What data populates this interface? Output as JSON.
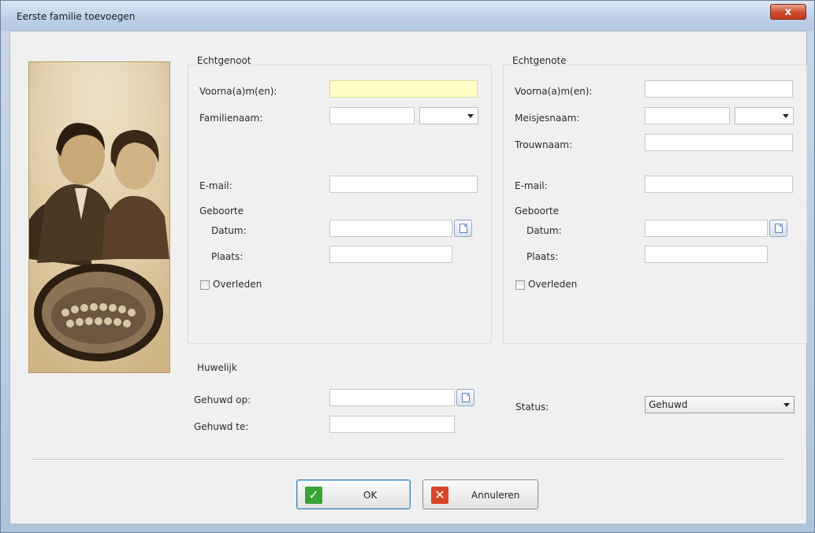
{
  "window": {
    "title": "Eerste familie toevoegen",
    "close_label": "x"
  },
  "husband": {
    "section_title": "Echtgenoot",
    "first_names_label": "Voorna(a)m(en):",
    "family_name_label": "Familienaam:",
    "email_label": "E-mail:",
    "birth_label": "Geboorte",
    "date_label": "Datum:",
    "place_label": "Plaats:",
    "deceased_label": "Overleden",
    "first_names_value": "",
    "family_name_value": "",
    "email_value": "",
    "birth_date_value": "",
    "birth_place_value": ""
  },
  "wife": {
    "section_title": "Echtgenote",
    "first_names_label": "Voorna(a)m(en):",
    "maiden_name_label": "Meisjesnaam:",
    "married_name_label": "Trouwnaam:",
    "email_label": "E-mail:",
    "birth_label": "Geboorte",
    "date_label": "Datum:",
    "place_label": "Plaats:",
    "deceased_label": "Overleden",
    "first_names_value": "",
    "maiden_name_value": "",
    "married_name_value": "",
    "email_value": "",
    "birth_date_value": "",
    "birth_place_value": ""
  },
  "marriage": {
    "section_title": "Huwelijk",
    "married_on_label": "Gehuwd op:",
    "married_at_label": "Gehuwd te:",
    "status_label": "Status:",
    "status_value": "Gehuwd",
    "married_on_value": "",
    "married_at_value": ""
  },
  "buttons": {
    "ok_label": "OK",
    "cancel_label": "Annuleren"
  },
  "colors": {
    "highlight_field": "#ffffc6",
    "ok_icon": "#3aa335",
    "cancel_icon": "#d9452b"
  },
  "icons": {
    "ok": "check-icon",
    "cancel": "x-icon",
    "calendar": "calendar-icon"
  }
}
